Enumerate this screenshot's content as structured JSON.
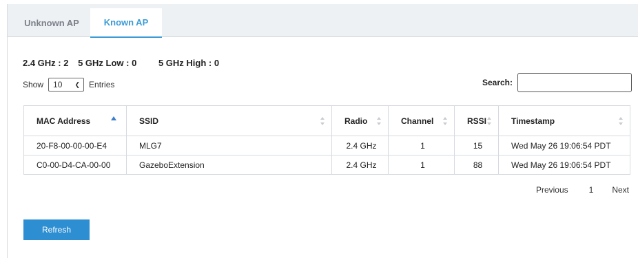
{
  "tabs": [
    {
      "label": "Unknown AP",
      "active": false
    },
    {
      "label": "Known AP",
      "active": true
    }
  ],
  "counts": {
    "band_24": "2.4 GHz : 2",
    "band_5low": "5 GHz Low : 0",
    "band_5high": "5 GHz High : 0"
  },
  "length": {
    "show_label": "Show",
    "selected": "10",
    "entries_label": "Entries"
  },
  "search": {
    "label": "Search:",
    "value": "",
    "placeholder": ""
  },
  "table": {
    "columns": [
      "MAC Address",
      "SSID",
      "Radio",
      "Channel",
      "RSSI",
      "Timestamp"
    ],
    "sorted_column": "MAC Address",
    "sort_direction": "ascending",
    "rows": [
      [
        "20-F8-00-00-00-E4",
        "MLG7",
        "2.4 GHz",
        "1",
        "15",
        "Wed May 26 19:06:54 PDT"
      ],
      [
        "C0-00-D4-CA-00-00",
        "GazeboExtension",
        "2.4 GHz",
        "1",
        "88",
        "Wed May 26 19:06:54 PDT"
      ]
    ]
  },
  "pagination": {
    "previous": "Previous",
    "page": "1",
    "next": "Next"
  },
  "actions": {
    "refresh": "Refresh"
  },
  "colors": {
    "accent": "#3b9bd6",
    "button": "#2d8fd2",
    "tabbar_bg": "#eef1f4"
  },
  "icons": {
    "sort_asc": "sort-ascending-icon",
    "sort_both": "sort-both-icon",
    "dropdown": "chevron-down-icon"
  }
}
